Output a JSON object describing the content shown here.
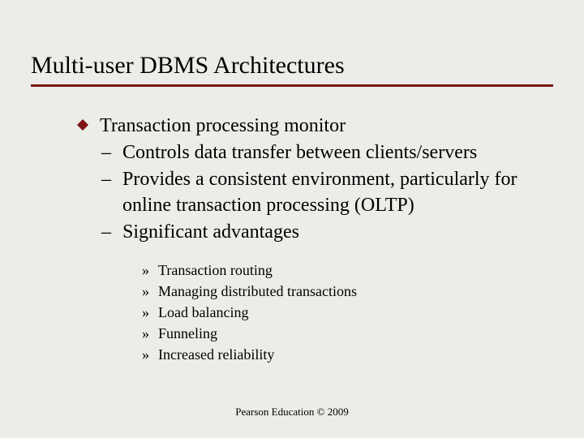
{
  "title": "Multi-user DBMS Architectures",
  "bullets": {
    "main": "Transaction processing monitor",
    "sub": [
      "Controls data transfer between clients/servers",
      "Provides a consistent environment, particularly for online transaction processing (OLTP)",
      "Significant advantages"
    ],
    "subsub": [
      "Transaction routing",
      "Managing distributed transactions",
      "Load balancing",
      "Funneling",
      "Increased reliability"
    ]
  },
  "footer": "Pearson Education © 2009",
  "colors": {
    "accent": "#7d1416"
  }
}
